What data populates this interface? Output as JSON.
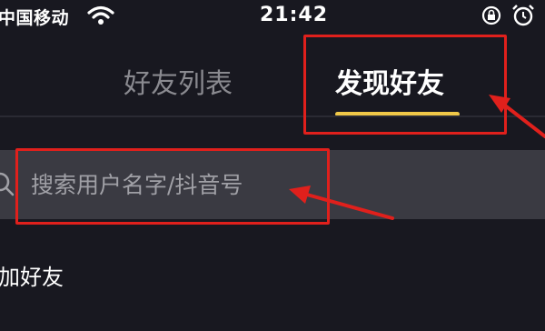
{
  "status_bar": {
    "carrier": "中国移动",
    "time": "21:42",
    "icons": [
      "wifi-icon",
      "lock-rotation-icon",
      "alarm-icon"
    ]
  },
  "tabs": [
    {
      "label": "好友列表",
      "active": false
    },
    {
      "label": "发现好友",
      "active": true
    }
  ],
  "search": {
    "placeholder": "搜索用户名字/抖音号"
  },
  "section": {
    "add_friends": "加好友"
  },
  "colors": {
    "background": "#181820",
    "active_tab_indicator": "#f0c848",
    "annotation_red": "#e0201c",
    "search_bg": "#3a3a42"
  }
}
